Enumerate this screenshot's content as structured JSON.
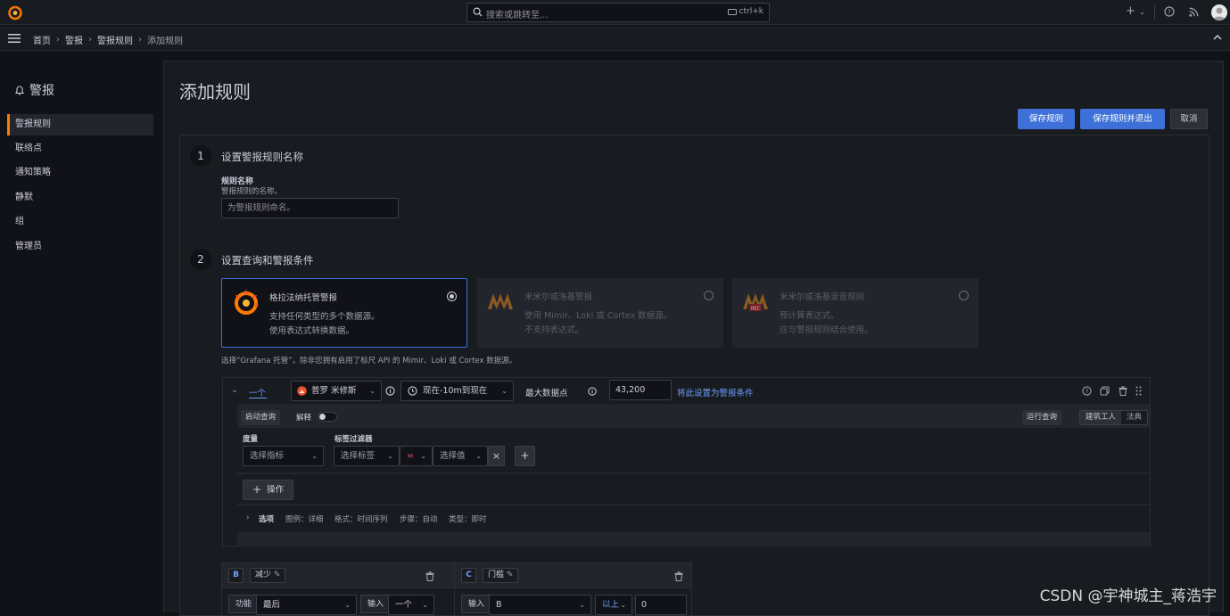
{
  "topbar": {
    "search_placeholder": "搜索或跳转至...",
    "shortcut": "ctrl+k",
    "add_label": "+",
    "add_caret": "⌄"
  },
  "breadcrumb": {
    "items": [
      "首页",
      "警报",
      "警报规则"
    ],
    "current": "添加规则"
  },
  "sidebar": {
    "title": "警报",
    "items": [
      {
        "label": "警报规则",
        "active": true
      },
      {
        "label": "联络点"
      },
      {
        "label": "通知策略"
      },
      {
        "label": "静默"
      },
      {
        "label": "组"
      },
      {
        "label": "管理员"
      }
    ]
  },
  "page": {
    "title": "添加规则",
    "save_label": "保存规则",
    "save_exit_label": "保存规则并退出",
    "cancel_label": "取消"
  },
  "step1": {
    "number": "1",
    "title": "设置警报规则名称",
    "field_label": "规则名称",
    "field_desc": "警报规则的名称。",
    "placeholder": "为警报规则命名。"
  },
  "step2": {
    "number": "2",
    "title": "设置查询和警报条件",
    "cards": [
      {
        "title": "格拉法纳托管警报",
        "desc1": "支持任何类型的多个数据源。",
        "desc2": "使用表达式转换数据。",
        "selected": true
      },
      {
        "title": "米米尔或洛基警报",
        "desc1": "使用 Mimir、Loki 或 Cortex 数据源。",
        "desc2": "不支持表达式。",
        "selected": false
      },
      {
        "title": "米米尔或洛基录音规则",
        "desc1": "预计算表达式。",
        "desc2": "应与警报规则结合使用。",
        "selected": false
      }
    ],
    "note": "选择“Grafana 托管”，除非您拥有启用了标尺 API 的 Mimir、Loki 或 Cortex 数据源。"
  },
  "query": {
    "ref": "一个",
    "datasource": "普罗 米修斯",
    "time_range": "现在-10m到现在",
    "max_points_label": "最大数据点",
    "max_points_value": "43,200",
    "set_condition_link": "将此设置为警报条件",
    "kickstart_label": "启动查询",
    "explain_label": "解释",
    "run_query_label": "运行查询",
    "builder_label": "建筑工人",
    "code_label": "法典",
    "metric_label": "度量",
    "metric_placeholder": "选择指标",
    "label_filters_label": "标签过滤器",
    "label_placeholder": "选择标签",
    "operator": "=",
    "value_placeholder": "选择值",
    "operations_label": "操作",
    "options_label": "选项",
    "options_summary": [
      "图例：详细",
      "格式：时间序列",
      "步骤：自动",
      "类型：即时"
    ]
  },
  "expr_b": {
    "ref": "B",
    "name": "减少",
    "function_label": "功能",
    "function_value": "最后",
    "input_label": "输入",
    "input_value": "一个"
  },
  "expr_c": {
    "ref": "C",
    "name": "门槛",
    "input_label": "输入",
    "input_value": "B",
    "op_value": "以上",
    "threshold_value": "0"
  },
  "watermark": "CSDN @宇神城主_蒋浩宇",
  "colors": {
    "primary": "#3d71d9",
    "accent": "#ff7a00",
    "link": "#6e9fff",
    "background": "#111217"
  }
}
